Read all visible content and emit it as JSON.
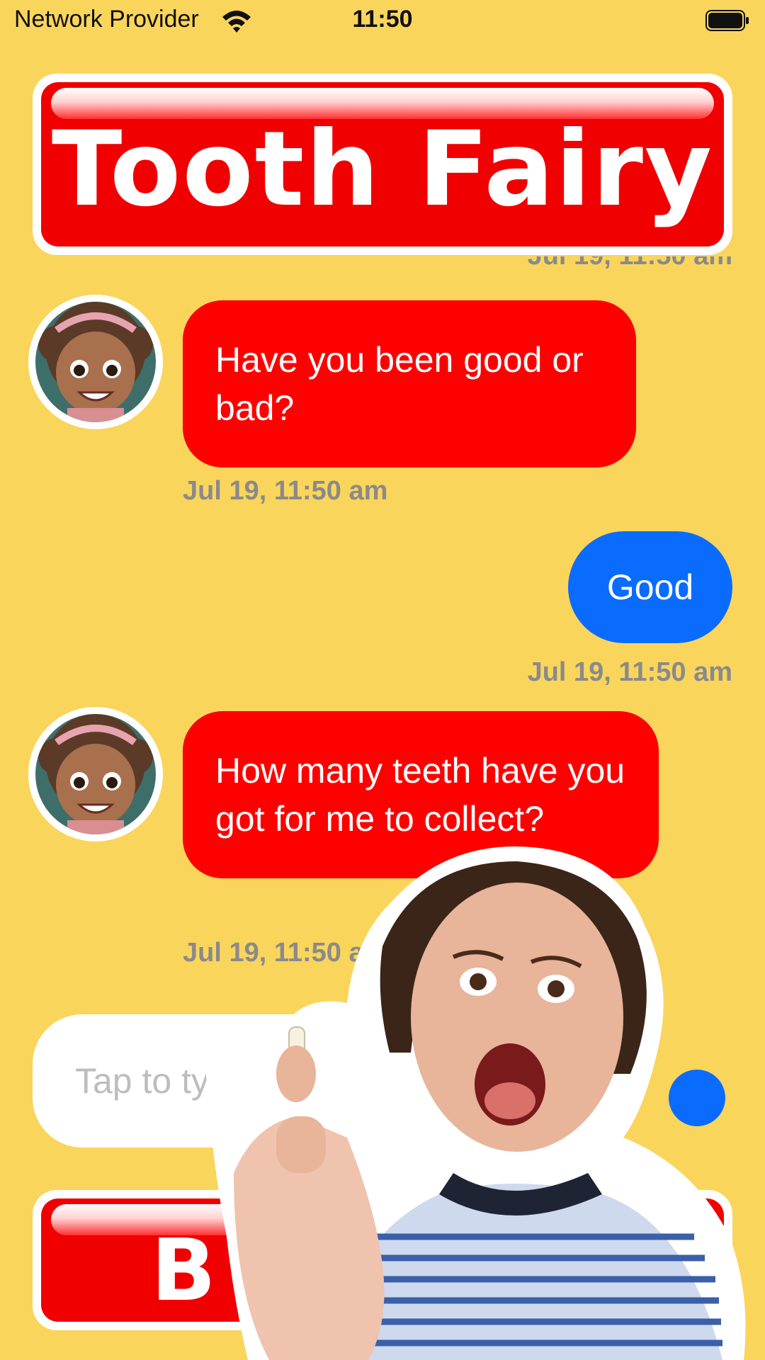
{
  "status_bar": {
    "carrier": "Network Provider",
    "time": "11:50"
  },
  "header": {
    "title": "Tooth Fairy"
  },
  "messages": [
    {
      "text": "Have you been good or bad?",
      "timestamp": "Jul 19, 11:50 am"
    },
    {
      "text": "Good",
      "timestamp": "Jul 19, 11:50 am"
    },
    {
      "text": "How many teeth have you got for me to collect?",
      "timestamp": "Jul 19, 11:50 am"
    }
  ],
  "clipped_timestamp": "Jul 19, 11:50 am",
  "composer": {
    "placeholder": "Tap to type"
  },
  "bottom_button": {
    "label": "B"
  },
  "colors": {
    "background": "#FAD55C",
    "banner_red": "#F00000",
    "incoming_bubble": "#FF0000",
    "outgoing_bubble": "#0A6CFF"
  }
}
